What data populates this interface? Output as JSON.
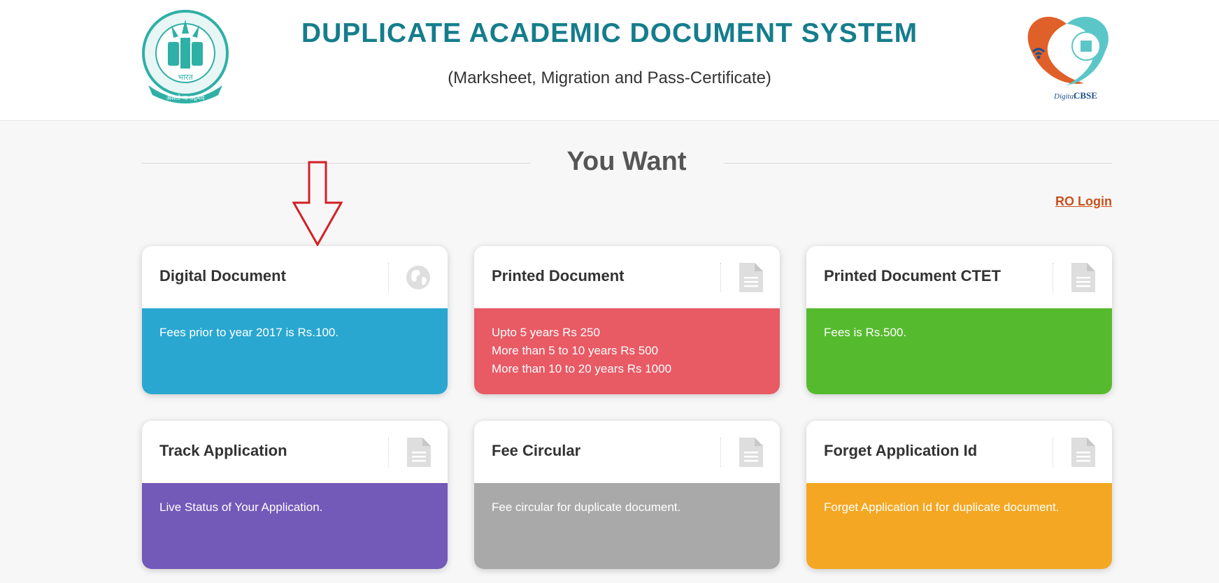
{
  "header": {
    "title": "DUPLICATE ACADEMIC DOCUMENT SYSTEM",
    "subtitle": "(Marksheet, Migration and Pass-Certificate)",
    "left_logo": {
      "text_top": "केन्द्रीय माध्यमिक शिक्षा बोर्ड",
      "text_mid": "भारत",
      "text_bottom": "असतो मा सद्गमय"
    },
    "right_logo": {
      "text": "Digital CBSE",
      "italic": "Digital",
      "bold": "CBSE"
    }
  },
  "section": {
    "title": "You Want"
  },
  "ro_login": "RO Login",
  "colors": {
    "brand_teal": "#157d8c",
    "blue": "#29a7d0",
    "red": "#e85a64",
    "green": "#56ba2f",
    "purple": "#7359b8",
    "grey": "#a9a9a9",
    "orange": "#f4a722",
    "link": "#c8511e",
    "arrow": "#d32027"
  },
  "cards": [
    {
      "title": "Digital Document",
      "icon": "globe-icon",
      "lines": [
        "Fees prior to year 2017 is Rs.100."
      ]
    },
    {
      "title": "Printed Document",
      "icon": "document-icon",
      "lines": [
        "Upto 5 years Rs 250",
        "More than 5 to 10 years Rs 500",
        "More than 10 to 20 years Rs 1000"
      ]
    },
    {
      "title": "Printed Document CTET",
      "icon": "document-icon",
      "lines": [
        "Fees is Rs.500."
      ]
    },
    {
      "title": "Track Application",
      "icon": "document-icon",
      "lines": [
        "Live Status of Your Application."
      ]
    },
    {
      "title": "Fee Circular",
      "icon": "document-icon",
      "lines": [
        "Fee circular for duplicate document."
      ]
    },
    {
      "title": "Forget Application Id",
      "icon": "document-icon",
      "lines": [
        "Forget Application Id for duplicate document."
      ]
    }
  ]
}
